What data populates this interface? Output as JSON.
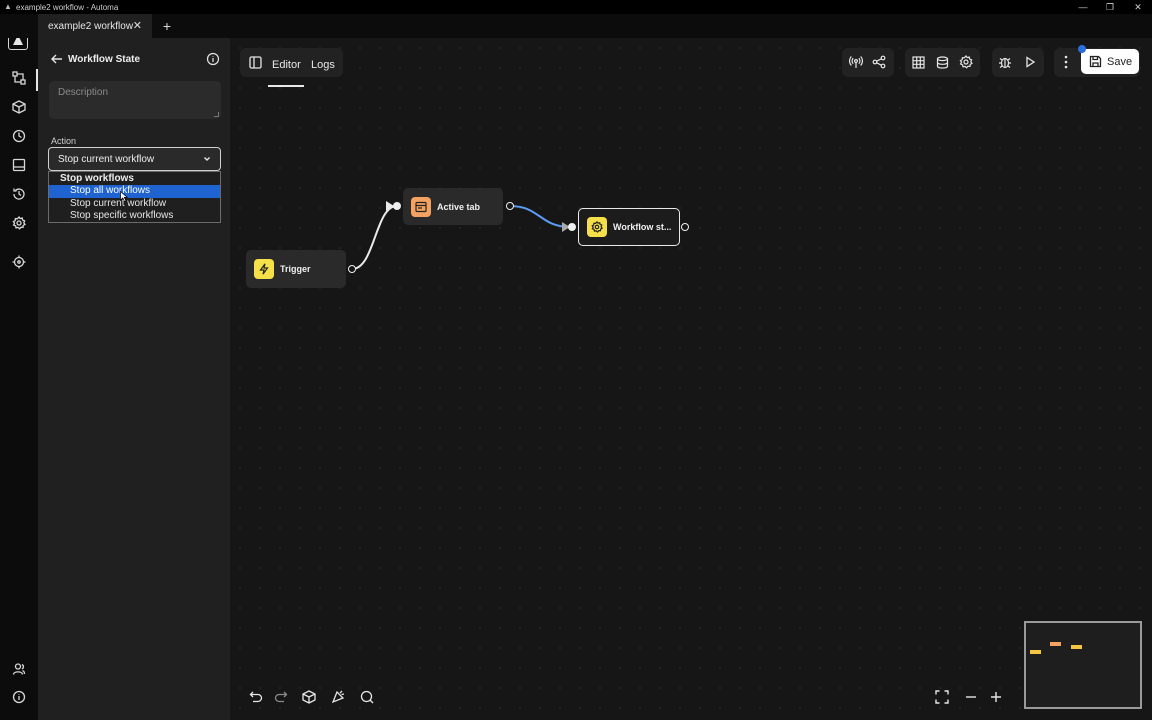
{
  "window": {
    "title": "example2 workflow - Automa"
  },
  "tab": {
    "label": "example2 workflow",
    "close": "✕",
    "new": "+"
  },
  "panel": {
    "title": "Workflow State",
    "description_placeholder": "Description",
    "action_label": "Action",
    "action_value": "Stop current workflow",
    "dropdown": {
      "group": "Stop workflows",
      "options": [
        "Stop all workflows",
        "Stop current workflow",
        "Stop specific workflows"
      ],
      "highlighted_index": 0
    }
  },
  "editor": {
    "tabs": [
      "Editor",
      "Logs"
    ],
    "active_tab": "Editor",
    "save_label": "Save"
  },
  "nodes": {
    "trigger": "Trigger",
    "active_tab": "Active tab",
    "workflow_state": "Workflow st..."
  },
  "colors": {
    "accent_blue": "#1e63d0",
    "node_yellow": "#f5e04a",
    "node_orange": "#f4a261",
    "edge_blue": "#5b9bf0"
  },
  "icons": {
    "rail": [
      "automa-logo-icon",
      "workflows-icon",
      "packages-icon",
      "schedule-icon",
      "storage-icon",
      "history-icon",
      "settings-icon",
      "crosshair-icon",
      "user-icon",
      "info-icon"
    ]
  }
}
